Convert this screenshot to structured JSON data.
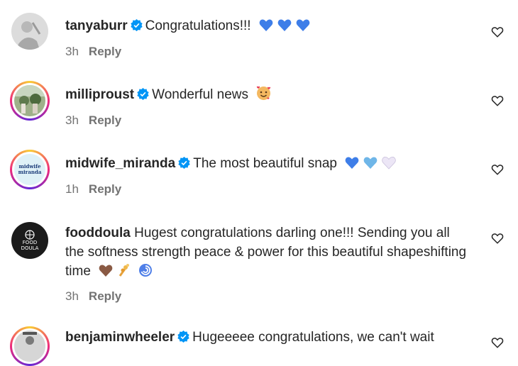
{
  "comments": [
    {
      "username": "tanyaburr",
      "text": "Congratulations!!!",
      "time": "3h",
      "reply": "Reply"
    },
    {
      "username": "milliproust",
      "text": "Wonderful news",
      "time": "3h",
      "reply": "Reply"
    },
    {
      "username": "midwife_miranda",
      "text": "The most beautiful snap",
      "time": "1h",
      "reply": "Reply",
      "avatar_text": "midwife miranda"
    },
    {
      "username": "fooddoula",
      "text": "Hugest congratulations darling one!!! Sending you all the softness strength peace & power for this beautiful shapeshifting time",
      "time": "3h",
      "reply": "Reply",
      "avatar_text": "FOOD DOULA"
    },
    {
      "username": "benjaminwheeler",
      "text": "Hugeeeee congratulations, we can't wait"
    }
  ],
  "icons": {
    "verified": "verified-badge-icon",
    "heart": "heart-outline-icon"
  },
  "colors": {
    "verified": "#0095f6",
    "meta": "#737373",
    "text": "#262626"
  }
}
